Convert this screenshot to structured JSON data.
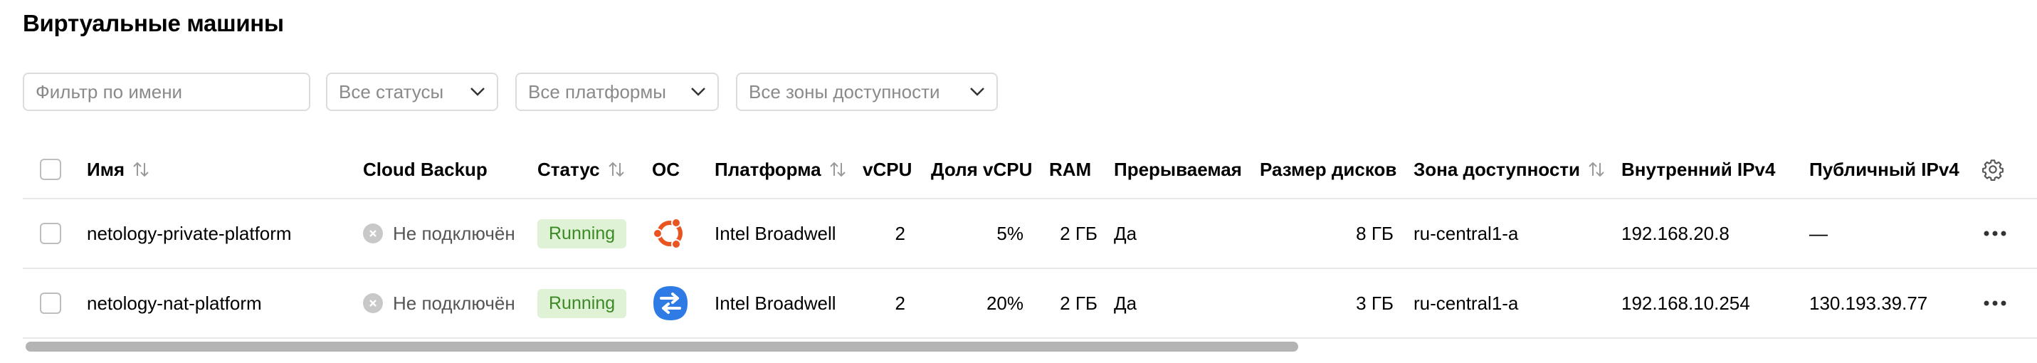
{
  "page": {
    "title": "Виртуальные машины"
  },
  "filters": {
    "name_placeholder": "Фильтр по имени",
    "status_value": "Все статусы",
    "platform_value": "Все платформы",
    "zone_value": "Все зоны доступности"
  },
  "table": {
    "columns": {
      "name": "Имя",
      "backup": "Cloud Backup",
      "status": "Статус",
      "os": "ОС",
      "platform": "Платформа",
      "vcpu": "vCPU",
      "vcpu_share": "Доля vCPU",
      "ram": "RAM",
      "preemptible": "Прерываемая",
      "disk_size": "Размер дисков",
      "zone": "Зона доступности",
      "internal_ip": "Внутренний IPv4",
      "public_ip": "Публичный IPv4"
    },
    "rows": [
      {
        "name": "netology-private-platform",
        "backup": "Не подключён",
        "status": "Running",
        "os_icon": "ubuntu-icon",
        "platform": "Intel Broadwell",
        "vcpu": "2",
        "vcpu_share": "5%",
        "ram": "2 ГБ",
        "preemptible": "Да",
        "disk_size": "8 ГБ",
        "zone": "ru-central1-a",
        "internal_ip": "192.168.20.8",
        "public_ip": "—"
      },
      {
        "name": "netology-nat-platform",
        "backup": "Не подключён",
        "status": "Running",
        "os_icon": "nat-instance-icon",
        "platform": "Intel Broadwell",
        "vcpu": "2",
        "vcpu_share": "20%",
        "ram": "2 ГБ",
        "preemptible": "Да",
        "disk_size": "3 ГБ",
        "zone": "ru-central1-a",
        "internal_ip": "192.168.10.254",
        "public_ip": "130.193.39.77"
      }
    ]
  },
  "colors": {
    "status_running_bg": "#dff2d6",
    "status_running_text": "#3b8a24",
    "ubuntu_orange": "#e95420",
    "nat_blue": "#2f7be6"
  },
  "icons": [
    "sort-icon",
    "chevron-down-icon",
    "gear-icon",
    "more-icon",
    "close-circle-icon"
  ]
}
